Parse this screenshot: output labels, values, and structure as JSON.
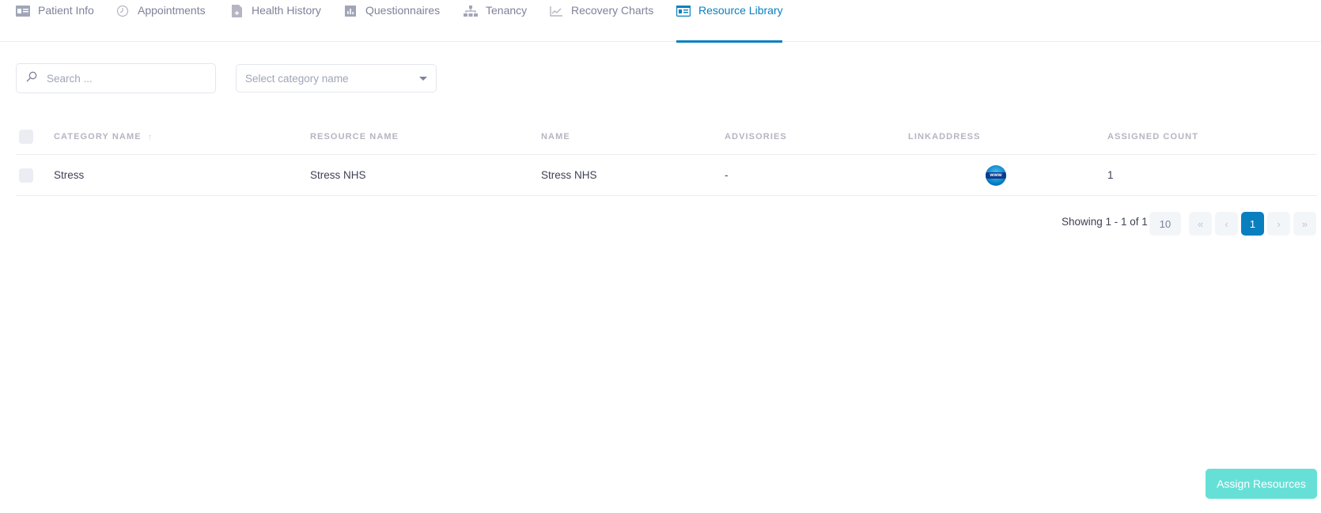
{
  "tabs": [
    {
      "label": "Patient Info",
      "icon": "id-card-icon",
      "active": false
    },
    {
      "label": "Appointments",
      "icon": "clock-icon",
      "active": false
    },
    {
      "label": "Health History",
      "icon": "file-plus-icon",
      "active": false
    },
    {
      "label": "Questionnaires",
      "icon": "bar-chart-icon",
      "active": false
    },
    {
      "label": "Tenancy",
      "icon": "sitemap-icon",
      "active": false
    },
    {
      "label": "Recovery Charts",
      "icon": "line-chart-icon",
      "active": false
    },
    {
      "label": "Resource Library",
      "icon": "id-card-icon",
      "active": true
    }
  ],
  "toolbar": {
    "search_placeholder": "Search ...",
    "category_placeholder": "Select category name"
  },
  "table": {
    "columns": [
      "Category Name",
      "Resource Name",
      "Name",
      "Advisories",
      "Linkaddress",
      "Assigned Count"
    ],
    "sorted_column": "Category Name",
    "sort_direction": "ascending",
    "rows": [
      {
        "category_name": "Stress",
        "resource_name": "Stress NHS",
        "name": "Stress NHS",
        "advisories": "-",
        "linkaddress_icon": "www-globe-icon",
        "assigned_count": "1"
      }
    ]
  },
  "pagination": {
    "info": "Showing 1 - 1 of 1",
    "page_size": "10",
    "first": "«",
    "prev": "‹",
    "current_page": "1",
    "next": "›",
    "last": "»"
  },
  "actions": {
    "assign_label": "Assign Resources"
  },
  "colors": {
    "accent": "#0a7fbf",
    "assign_button": "#66e0d7",
    "muted_text": "#7e8299"
  }
}
